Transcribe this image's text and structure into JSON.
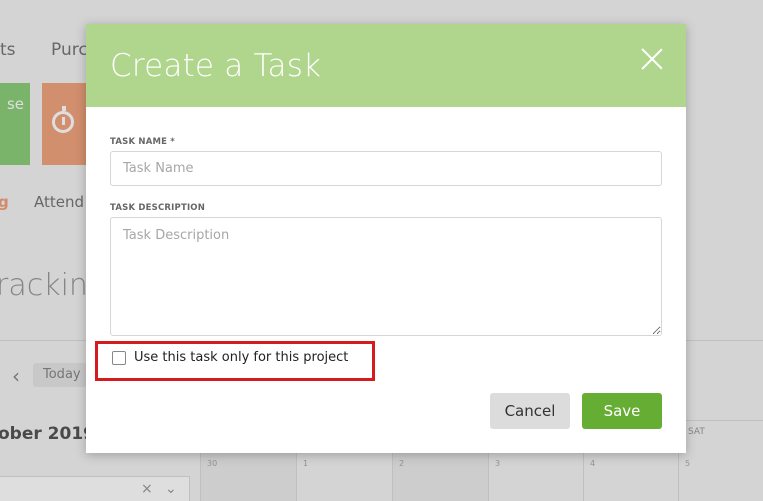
{
  "background": {
    "nav_left": "ts",
    "nav_right": "Purc",
    "tile_text": "se",
    "tab_active": "g",
    "tab_attendance": "Attend",
    "page_heading": "racking",
    "today_button": "Today",
    "month_label": "ober 2019",
    "day_header": "SAT",
    "day_numbers": [
      "30",
      "1",
      "2",
      "3",
      "4",
      "5"
    ]
  },
  "modal": {
    "title": "Create a Task",
    "task_name_label": "TASK NAME *",
    "task_name_placeholder": "Task Name",
    "task_name_value": "",
    "task_description_label": "TASK DESCRIPTION",
    "task_description_placeholder": "Task Description",
    "task_description_value": "",
    "project_only_label": "Use this task only for this project",
    "project_only_checked": false,
    "cancel_label": "Cancel",
    "save_label": "Save"
  },
  "colors": {
    "header": "#b0d68d",
    "save": "#66ad34",
    "highlight": "#d51b1e"
  }
}
